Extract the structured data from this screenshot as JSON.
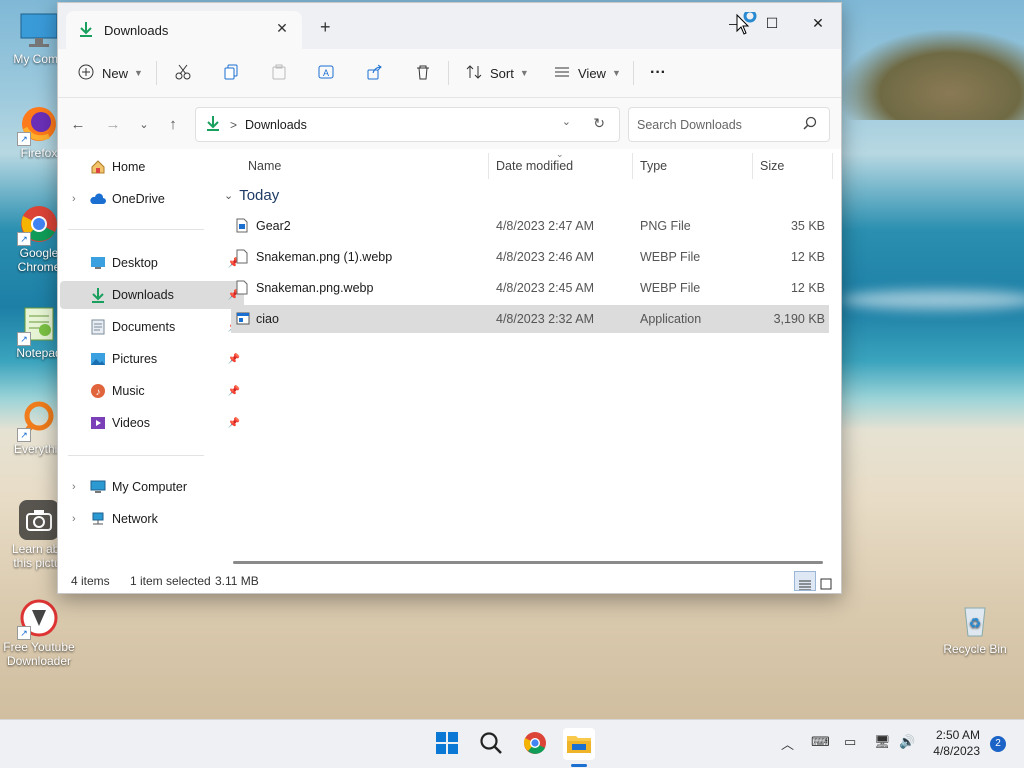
{
  "desktop": {
    "icons": [
      {
        "label": "My Comp",
        "name": "my-computer"
      },
      {
        "label": "Firefox",
        "name": "firefox"
      },
      {
        "label": "Google Chrome",
        "name": "chrome"
      },
      {
        "label": "Notepad",
        "name": "notepad"
      },
      {
        "label": "Everythin",
        "name": "everything"
      },
      {
        "label": "Learn abo this pictur",
        "name": "learn-about-picture"
      },
      {
        "label": "Free Youtube Downloader",
        "name": "free-youtube-downloader"
      },
      {
        "label": "Recycle Bin",
        "name": "recycle-bin"
      }
    ]
  },
  "window": {
    "tab_title": "Downloads",
    "new_tab": "+",
    "toolbar": {
      "new_label": "New",
      "sort_label": "Sort",
      "view_label": "View",
      "more_label": "···"
    },
    "address": {
      "crumb_sep": ">",
      "location": "Downloads",
      "search_placeholder": "Search Downloads"
    },
    "sidebar": {
      "items": [
        {
          "label": "Home"
        },
        {
          "label": "OneDrive"
        },
        {
          "label": "Desktop"
        },
        {
          "label": "Downloads"
        },
        {
          "label": "Documents"
        },
        {
          "label": "Pictures"
        },
        {
          "label": "Music"
        },
        {
          "label": "Videos"
        },
        {
          "label": "My Computer"
        },
        {
          "label": "Network"
        }
      ]
    },
    "columns": {
      "name": "Name",
      "date": "Date modified",
      "type": "Type",
      "size": "Size"
    },
    "group_label": "Today",
    "files": [
      {
        "name": "Gear2",
        "date": "4/8/2023 2:47 AM",
        "type": "PNG File",
        "size": "35 KB"
      },
      {
        "name": "Snakeman.png (1).webp",
        "date": "4/8/2023 2:46 AM",
        "type": "WEBP File",
        "size": "12 KB"
      },
      {
        "name": "Snakeman.png.webp",
        "date": "4/8/2023 2:45 AM",
        "type": "WEBP File",
        "size": "12 KB"
      },
      {
        "name": "ciao",
        "date": "4/8/2023 2:32 AM",
        "type": "Application",
        "size": "3,190 KB"
      }
    ],
    "status": {
      "items": "4 items",
      "selected": "1 item selected",
      "size": "3.11 MB"
    }
  },
  "taskbar": {
    "time": "2:50 AM",
    "date": "4/8/2023",
    "notifications": "2"
  }
}
